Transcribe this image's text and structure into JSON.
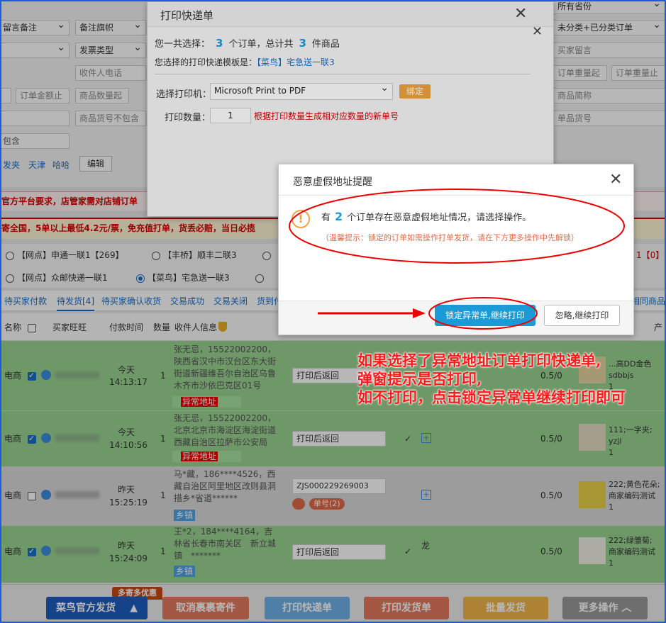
{
  "filters": {
    "remark_select": "留言备注",
    "remark_flag": "备注旗帜",
    "invoice_type": "发票类型",
    "receiver_phone_ph": "收件人电话",
    "order_amount_ph": "订单金额止",
    "goods_qty_ph": "商品数量起",
    "goods_code_excl_ph": "商品货号不包含",
    "contains_ph": "包含",
    "category_select": "未分类+已分类订单",
    "buyer_msg_ph": "买家留言",
    "order_weight_from_ph": "订单重量起",
    "order_weight_to_ph": "订单重量止",
    "goods_short_ph": "商品简称",
    "sku_code_ph": "单品货号",
    "all_select": "所有省份",
    "edit_label": "编辑",
    "quick_links": [
      "发夹",
      "天津",
      "哈哈"
    ]
  },
  "notices": {
    "official_req": "官方平台要求，店管家需对店铺订单",
    "promo": "寄全国，5单以上最低4.2元/票，免充值打单，货丢必赔，当日必揽"
  },
  "templates": [
    {
      "label": "【网点】申通一联1【269】",
      "checked": false
    },
    {
      "label": "【丰桥】顺丰二联3",
      "checked": false
    },
    {
      "label": "【网点】众邮快递一联1",
      "checked": false
    },
    {
      "label": "【菜鸟】宅急送一联3",
      "checked": true
    }
  ],
  "template_right": "1【0】",
  "status_tabs": [
    "待买家付款",
    "待发货[4]",
    "待买家确认收货",
    "交易成功",
    "交易关闭",
    "货到付"
  ],
  "right_tab": "相同商品",
  "table_headers": {
    "name": "名称",
    "buyer": "买家旺旺",
    "pay_time": "付款时间",
    "qty": "数量",
    "receiver": "收件人信息",
    "product": "产"
  },
  "orders": [
    {
      "shop": "电商",
      "checked": true,
      "day": "今天",
      "time": "14:13:17",
      "qty": "1",
      "address": "张无忌，15522002200，陕西省汉中市汉台区东大街街道新疆维吾尔自治区乌鲁木齐市沙依巴克区01号",
      "tag": "异常地址",
      "tag_type": "warn",
      "print_state": "打印后返回",
      "ratio": "0.5/0",
      "product": "...高DD金色",
      "product2": "sdbbjs",
      "product_qty": "1"
    },
    {
      "shop": "电商",
      "checked": true,
      "day": "今天",
      "time": "14:10:56",
      "qty": "1",
      "address": "张无忌，15522002200，北京北京市海淀区海淀街道西藏自治区拉萨市公安局",
      "tag": "异常地址",
      "tag_type": "warn",
      "print_state": "打印后返回",
      "ratio": "0.5/0",
      "product": "111;一字夹;",
      "product2": "yzjl",
      "product_qty": "1"
    },
    {
      "shop": "电商",
      "checked": false,
      "day": "昨天",
      "time": "15:25:19",
      "qty": "1",
      "address": "马*藏，186****4526，西藏自治区阿里地区改则县洞措乡*省道******",
      "tag": "乡镇",
      "tag_type": "info",
      "print_state": "ZJS000229269003",
      "extra": "单号(2)",
      "ratio": "0.5/0",
      "product": "222;黄色花朵;",
      "product2": "商家编码测试",
      "product_qty": "1"
    },
    {
      "shop": "电商",
      "checked": true,
      "day": "昨天",
      "time": "15:24:09",
      "qty": "1",
      "address": "王*2，184****4164，吉林省长春市南关区　新立城镇　*******",
      "tag": "乡镇",
      "tag_type": "info",
      "print_state": "打印后返回",
      "ratio": "0.5/0",
      "mark": "龙",
      "product": "222;绿雏菊;",
      "product2": "商家编码测试",
      "product_qty": "1"
    }
  ],
  "bottom_bar": {
    "badge": "多寄多优惠",
    "cainiao": "菜鸟官方发货",
    "cancel": "取消裹裹寄件",
    "print_express": "打印快递单",
    "print_invoice": "打印发货单",
    "batch_ship": "批量发货",
    "more": "更多操作"
  },
  "print_dialog": {
    "title": "打印快递单",
    "sel_prefix": "您一共选择：",
    "order_count": "3",
    "order_unit": "个订单，总计共",
    "goods_count": "3",
    "goods_unit": "件商品",
    "template_prefix": "您选择的打印快递模板是：",
    "template_name": "【菜鸟】宅急送一联3",
    "printer_label": "选择打印机：",
    "printer_value": "Microsoft Print to PDF",
    "bind_label": "绑定",
    "copies_label": "打印数量：",
    "copies_value": "1",
    "copies_hint": "根据打印数量生成相对应数量的新单号"
  },
  "alert_dialog": {
    "title": "恶意虚假地址提醒",
    "msg_prefix": "有",
    "count": "2",
    "msg_suffix": "个订单存在恶意虚假地址情况，请选择操作。",
    "tip": "（温馨提示：锁定的订单如需操作打单发货，请在下方更多操作中先解锁）",
    "lock_btn": "锁定异常单,继续打印",
    "ignore_btn": "忽略,继续打印"
  },
  "annotation": {
    "line1": "如果选择了异常地址订单打印快递单,",
    "line2": "弹窗提示是否打印,",
    "line3": "如不打印，点击锁定异常单继续打印即可"
  },
  "colors": {
    "accent": "#1a6fc9",
    "row_green": "#9bd492",
    "warn_red": "#e00000",
    "annotation": "#ff0000"
  }
}
